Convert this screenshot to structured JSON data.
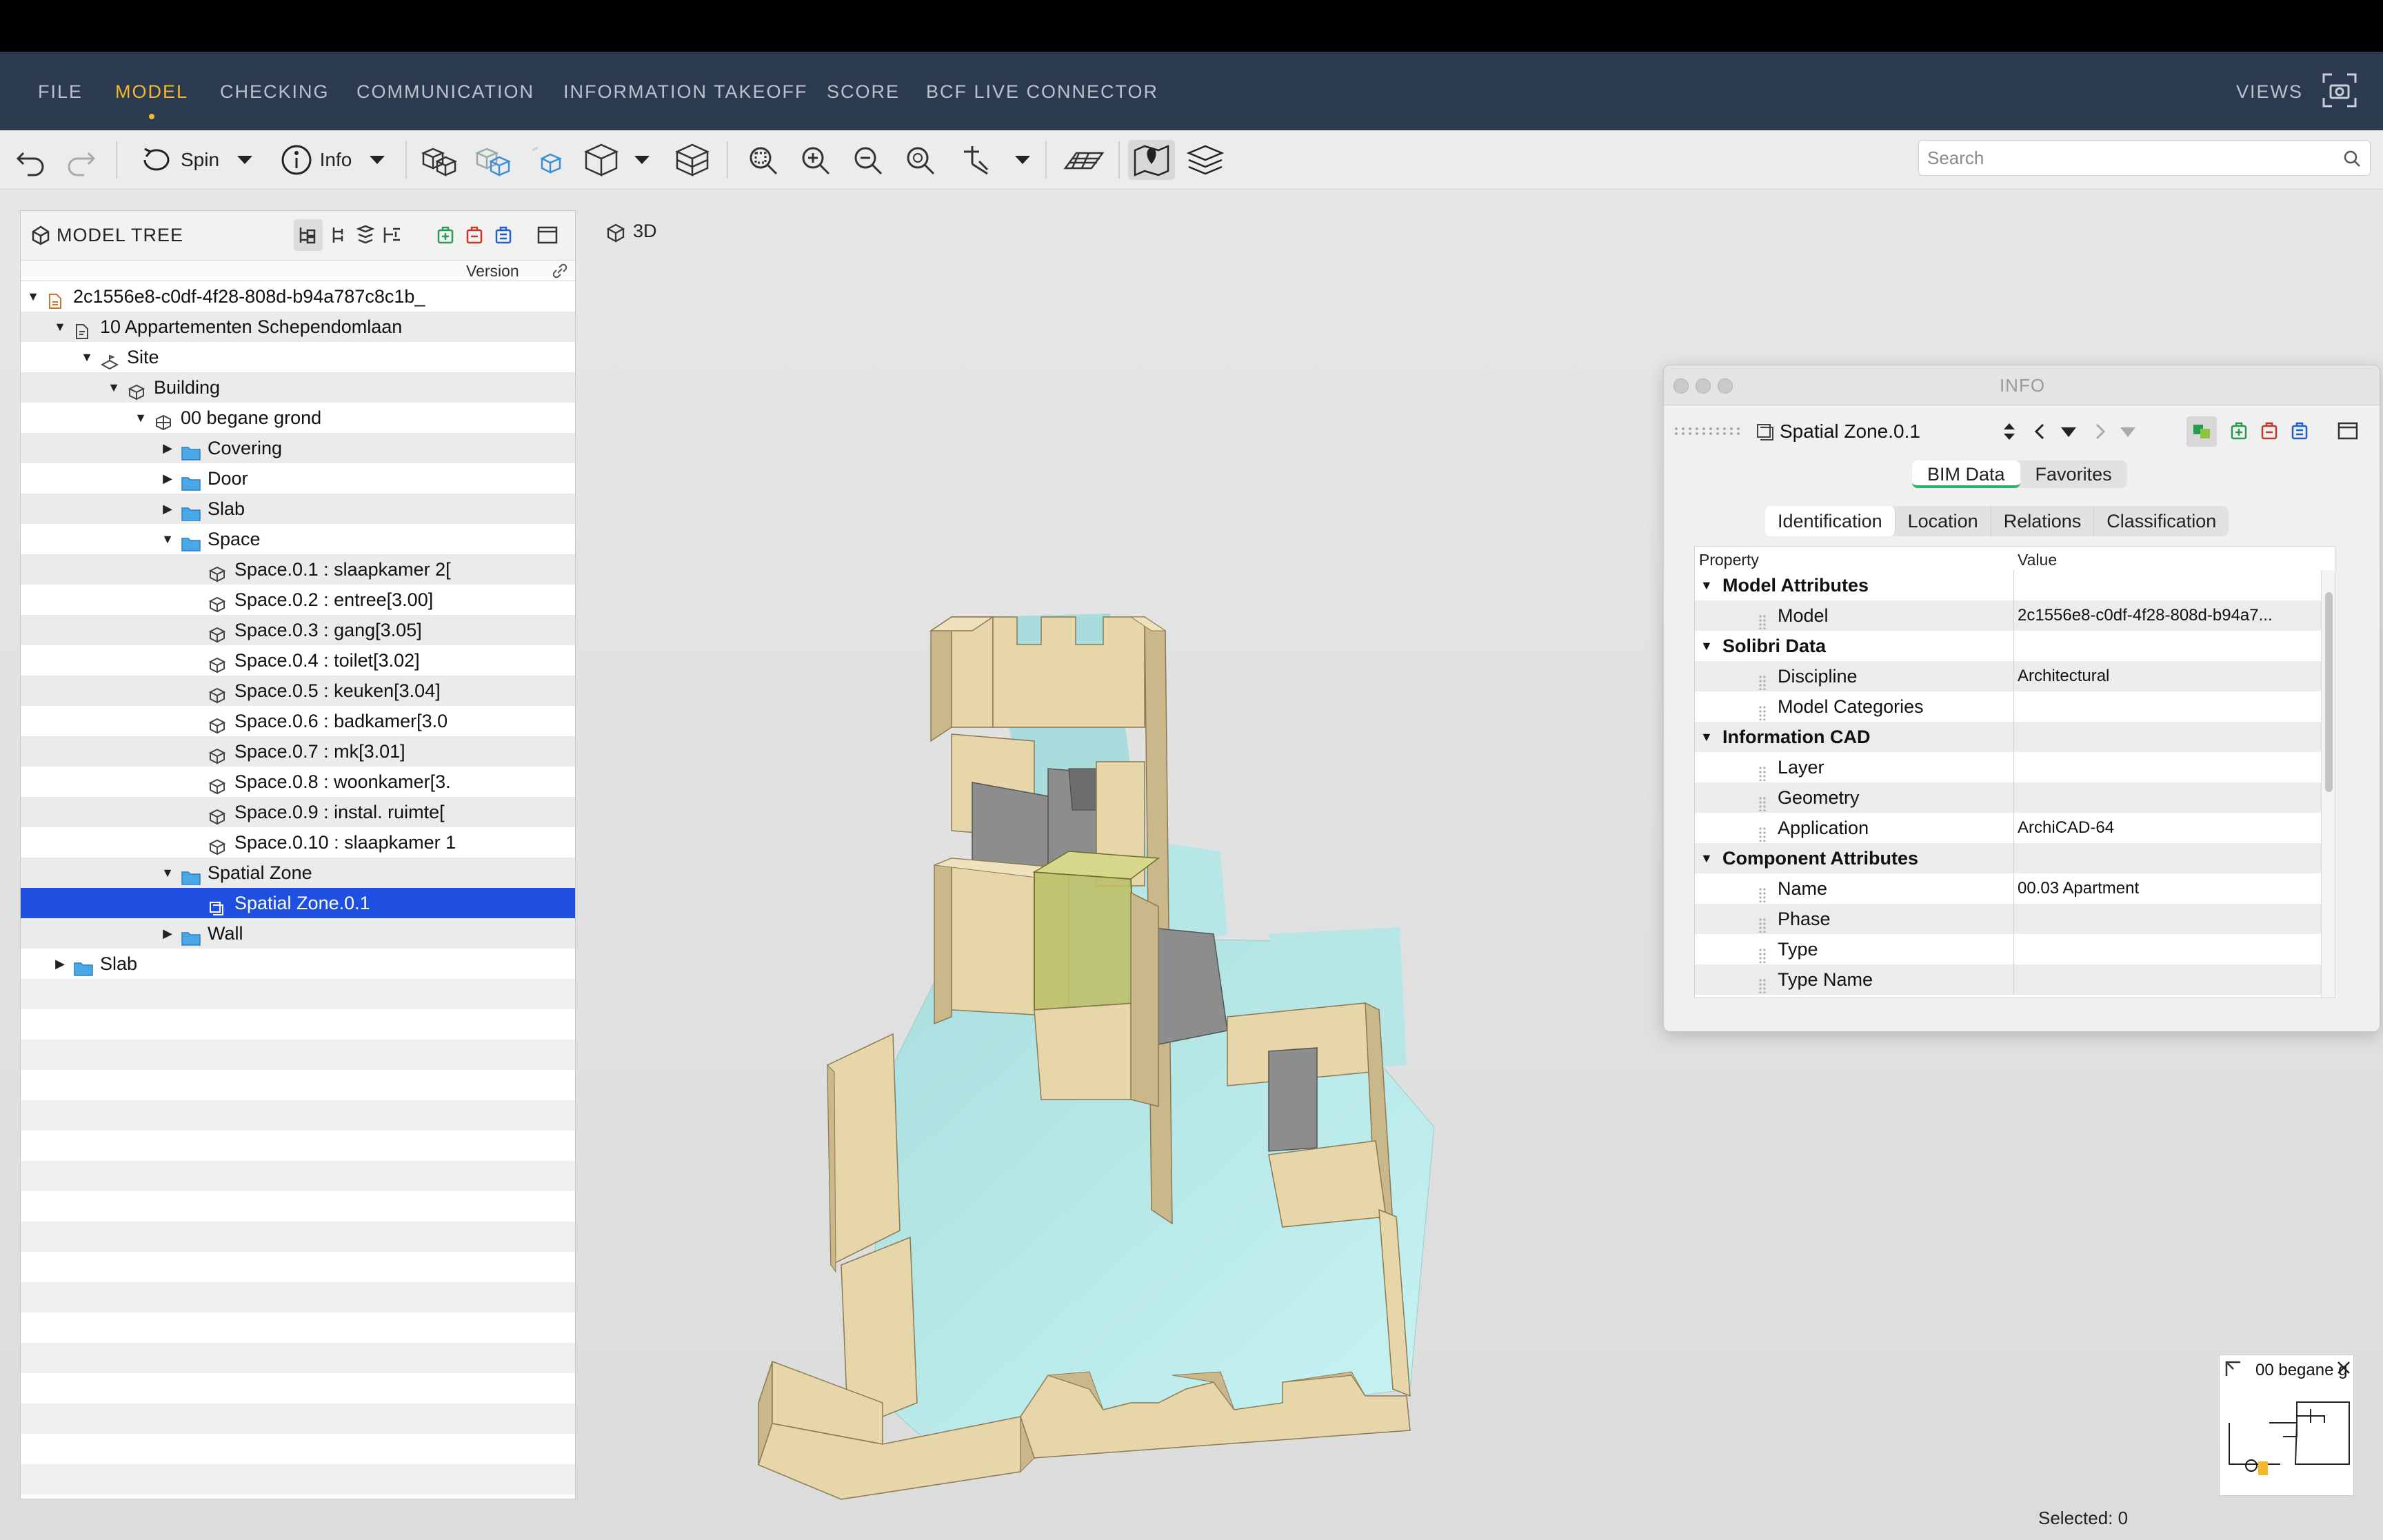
{
  "menu": {
    "items": [
      "FILE",
      "MODEL",
      "CHECKING",
      "COMMUNICATION",
      "INFORMATION TAKEOFF",
      "SCORE",
      "BCF LIVE CONNECTOR"
    ],
    "active": "MODEL",
    "views_label": "VIEWS"
  },
  "toolbar": {
    "spin_label": "Spin",
    "info_label": "Info",
    "search_placeholder": "Search"
  },
  "model_tree": {
    "title": "MODEL TREE",
    "column_version": "Version",
    "rows": [
      {
        "text": "2c1556e8-c0df-4f28-808d-b94a787c8c1b_",
        "icon": "model-file-icon",
        "state": "open"
      },
      {
        "text": "10 Appartementen Schependomlaan",
        "icon": "project-icon",
        "state": "open"
      },
      {
        "text": "Site",
        "icon": "site-icon",
        "state": "open"
      },
      {
        "text": "Building",
        "icon": "building-icon",
        "state": "open"
      },
      {
        "text": "00 begane grond",
        "icon": "storey-icon",
        "state": "open"
      },
      {
        "text": "Covering",
        "icon": "folder-icon",
        "state": "closed"
      },
      {
        "text": "Door",
        "icon": "folder-icon",
        "state": "closed"
      },
      {
        "text": "Slab",
        "icon": "folder-icon",
        "state": "closed"
      },
      {
        "text": "Space",
        "icon": "folder-icon",
        "state": "open"
      },
      {
        "text": "Space.0.1 : slaapkamer 2[",
        "icon": "space-icon",
        "state": "leaf"
      },
      {
        "text": "Space.0.2 : entree[3.00]",
        "icon": "space-icon",
        "state": "leaf"
      },
      {
        "text": "Space.0.3 : gang[3.05]",
        "icon": "space-icon",
        "state": "leaf"
      },
      {
        "text": "Space.0.4 : toilet[3.02]",
        "icon": "space-icon",
        "state": "leaf"
      },
      {
        "text": "Space.0.5 : keuken[3.04]",
        "icon": "space-icon",
        "state": "leaf"
      },
      {
        "text": "Space.0.6 : badkamer[3.0",
        "icon": "space-icon",
        "state": "leaf"
      },
      {
        "text": "Space.0.7 : mk[3.01]",
        "icon": "space-icon",
        "state": "leaf"
      },
      {
        "text": "Space.0.8 : woonkamer[3.",
        "icon": "space-icon",
        "state": "leaf"
      },
      {
        "text": "Space.0.9 : instal. ruimte[",
        "icon": "space-icon",
        "state": "leaf"
      },
      {
        "text": "Space.0.10 : slaapkamer 1",
        "icon": "space-icon",
        "state": "leaf"
      },
      {
        "text": "Spatial Zone",
        "icon": "folder-icon",
        "state": "open"
      },
      {
        "text": "Spatial Zone.0.1",
        "icon": "zone-icon",
        "state": "leaf",
        "selected": true
      },
      {
        "text": "Wall",
        "icon": "folder-icon",
        "state": "closed"
      },
      {
        "text": "Slab",
        "icon": "folder-icon",
        "state": "closed"
      }
    ]
  },
  "view": {
    "label": "3D"
  },
  "info_panel": {
    "title": "INFO",
    "selected_name": "Spatial Zone.0.1",
    "tabs_top": [
      "BIM Data",
      "Favorites"
    ],
    "tabs_top_active": "BIM Data",
    "tabs_sub": [
      "Identification",
      "Location",
      "Relations",
      "Classification"
    ],
    "tabs_sub_active": "Identification",
    "col_property": "Property",
    "col_value": "Value",
    "rows": [
      {
        "group": true,
        "name": "Model Attributes",
        "value": ""
      },
      {
        "group": false,
        "name": "Model",
        "value": "2c1556e8-c0df-4f28-808d-b94a7..."
      },
      {
        "group": true,
        "name": "Solibri Data",
        "value": ""
      },
      {
        "group": false,
        "name": "Discipline",
        "value": "Architectural"
      },
      {
        "group": false,
        "name": "Model Categories",
        "value": ""
      },
      {
        "group": true,
        "name": "Information CAD",
        "value": ""
      },
      {
        "group": false,
        "name": "Layer",
        "value": ""
      },
      {
        "group": false,
        "name": "Geometry",
        "value": ""
      },
      {
        "group": false,
        "name": "Application",
        "value": "ArchiCAD-64"
      },
      {
        "group": true,
        "name": "Component Attributes",
        "value": ""
      },
      {
        "group": false,
        "name": "Name",
        "value": "00.03 Apartment"
      },
      {
        "group": false,
        "name": "Phase",
        "value": ""
      },
      {
        "group": false,
        "name": "Type",
        "value": ""
      },
      {
        "group": false,
        "name": "Type Name",
        "value": ""
      }
    ]
  },
  "minimap": {
    "label": "00 begane g"
  },
  "status": {
    "selected": "Selected: 0"
  },
  "colors": {
    "menubar": "#2c3a4f",
    "accent": "#f3b82b",
    "selection": "#1f4fe0",
    "tab_underline": "#27b26b",
    "wall": "#e6d6aa",
    "space_floor": "#b8ecec"
  }
}
